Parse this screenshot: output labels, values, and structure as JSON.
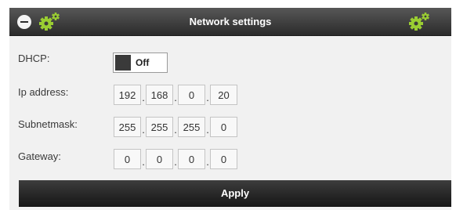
{
  "header": {
    "title": "Network settings"
  },
  "icons": {
    "collapse": "minus-circle-icon",
    "settings": "gears-icon"
  },
  "colors": {
    "header_bg": "#3a3a3a",
    "gear_green": "#9acd32",
    "panel_bg": "#f1f1f1"
  },
  "form": {
    "dhcp": {
      "label": "DHCP:",
      "state": "Off"
    },
    "ip": {
      "label": "Ip address:",
      "octets": [
        "192",
        "168",
        "0",
        "20"
      ]
    },
    "subnet": {
      "label": "Subnetmask:",
      "octets": [
        "255",
        "255",
        "255",
        "0"
      ]
    },
    "gateway": {
      "label": "Gateway:",
      "octets": [
        "0",
        "0",
        "0",
        "0"
      ]
    },
    "separator": "."
  },
  "actions": {
    "apply_label": "Apply"
  }
}
